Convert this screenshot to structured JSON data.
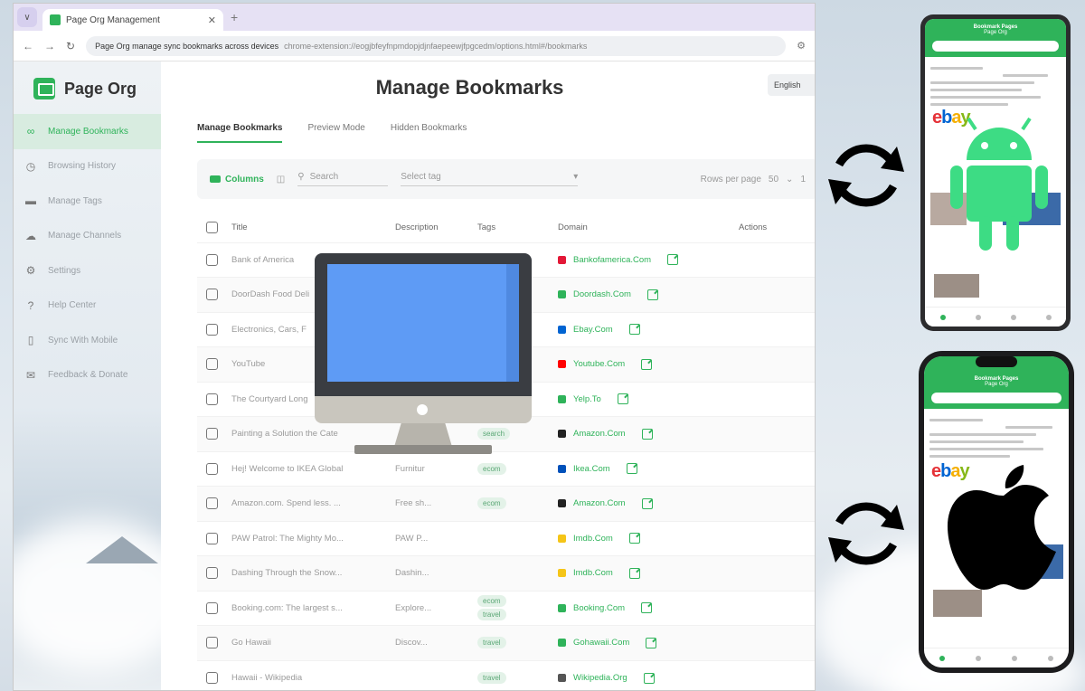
{
  "browser": {
    "tab_title": "Page Org Management",
    "url_host": "Page Org manage sync bookmarks across devices",
    "url_path": "chrome-extension://eogjbfeyfnpmdopjdjnfaepeewjfpgcedm/options.html#/bookmarks"
  },
  "sidebar": {
    "brand": "Page Org",
    "items": [
      {
        "label": "Manage Bookmarks",
        "icon": "bookmarks-icon"
      },
      {
        "label": "Browsing History",
        "icon": "history-icon"
      },
      {
        "label": "Manage Tags",
        "icon": "tag-icon"
      },
      {
        "label": "Manage Channels",
        "icon": "cloud-icon"
      },
      {
        "label": "Settings",
        "icon": "gear-icon"
      },
      {
        "label": "Help Center",
        "icon": "help-icon"
      },
      {
        "label": "Sync With Mobile",
        "icon": "phone-icon"
      },
      {
        "label": "Feedback & Donate",
        "icon": "feedback-icon"
      }
    ]
  },
  "main": {
    "title": "Manage Bookmarks",
    "lang_button": "English",
    "tabs": [
      "Manage Bookmarks",
      "Preview Mode",
      "Hidden Bookmarks"
    ],
    "toolbar": {
      "columns": "Columns",
      "search_placeholder": "Search",
      "tag_placeholder": "Select tag",
      "rows_per_page_label": "Rows per page",
      "rows_per_page_value": "50",
      "page": "1"
    },
    "table": {
      "headers": [
        "Title",
        "Description",
        "Tags",
        "Domain",
        "Actions"
      ],
      "rows": [
        {
          "title": "Bank of America",
          "desc": "",
          "tags": [],
          "domain": "Bankofamerica.Com",
          "color": "#e31837"
        },
        {
          "title": "DoorDash Food Deli",
          "desc": "",
          "tags": [],
          "domain": "Doordash.Com",
          "color": "#2fb35a"
        },
        {
          "title": "Electronics, Cars, F",
          "desc": "",
          "tags": [],
          "domain": "Ebay.Com",
          "color": "#0064d2"
        },
        {
          "title": "YouTube",
          "desc": "",
          "tags": [],
          "domain": "Youtube.Com",
          "color": "#ff0000"
        },
        {
          "title": "The Courtyard Long",
          "desc": "",
          "tags": [],
          "domain": "Yelp.To",
          "color": "#2fb35a"
        },
        {
          "title": "Painting a Solution the Cate",
          "desc": "",
          "tags": [
            "search"
          ],
          "domain": "Amazon.Com",
          "color": "#222222"
        },
        {
          "title": "Hej! Welcome to IKEA Global",
          "desc": "Furnitur",
          "tags": [
            "ecom"
          ],
          "domain": "Ikea.Com",
          "color": "#0051ba"
        },
        {
          "title": "Amazon.com. Spend less. ...",
          "desc": "Free sh...",
          "tags": [
            "ecom"
          ],
          "domain": "Amazon.Com",
          "color": "#222222"
        },
        {
          "title": "PAW Patrol: The Mighty Mo...",
          "desc": "PAW P...",
          "tags": [],
          "domain": "Imdb.Com",
          "color": "#f5c518"
        },
        {
          "title": "Dashing Through the Snow...",
          "desc": "Dashin...",
          "tags": [],
          "domain": "Imdb.Com",
          "color": "#f5c518"
        },
        {
          "title": "Booking.com: The largest s...",
          "desc": "Explore...",
          "tags": [
            "ecom",
            "travel"
          ],
          "domain": "Booking.Com",
          "color": "#2fb35a"
        },
        {
          "title": "Go Hawaii",
          "desc": "Discov...",
          "tags": [
            "travel"
          ],
          "domain": "Gohawaii.Com",
          "color": "#2fb35a"
        },
        {
          "title": "Hawaii - Wikipedia",
          "desc": "",
          "tags": [
            "travel"
          ],
          "domain": "Wikipedia.Org",
          "color": "#555555"
        }
      ]
    }
  },
  "overlay": {
    "desktop": "monitor-icon",
    "sync": "sync-icon",
    "android_header": "Bookmark Pages",
    "android_sub": "Page Org",
    "iphone_header": "Bookmark Pages",
    "iphone_sub": "Page Org",
    "accent": "#2fb35a"
  }
}
